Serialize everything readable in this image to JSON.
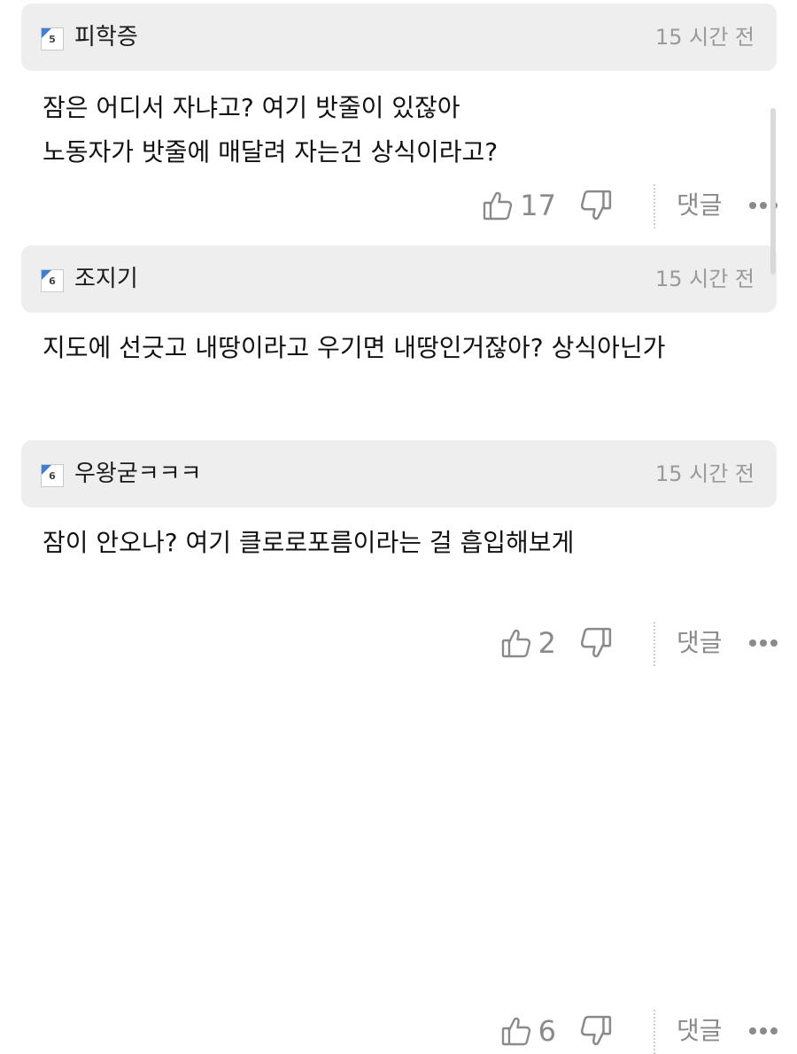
{
  "comments": [
    {
      "level": "5",
      "nickname": "피학증",
      "time": "15 시간 전",
      "lines": [
        "잠은 어디서 자냐고? 여기 밧줄이 있잖아",
        "노동자가 밧줄에 매달려 자는건 상식이라고?"
      ],
      "likes": "17",
      "reply_label": "댓글"
    },
    {
      "level": "6",
      "nickname": "조지기",
      "time": "15 시간 전",
      "lines": [
        "지도에 선긋고 내땅이라고 우기면 내땅인거잖아? 상식아닌가"
      ],
      "likes": "2",
      "reply_label": "댓글"
    },
    {
      "level": "6",
      "nickname": "우왕굳ㅋㅋㅋ",
      "time": "15 시간 전",
      "lines": [
        "잠이 안오나? 여기 클로로포름이라는 걸 흡입해보게"
      ],
      "likes": "6",
      "reply_label": "댓글"
    }
  ],
  "icons": {
    "level_badge": "level-badge-icon",
    "like": "thumbs-up-icon",
    "dislike": "thumbs-down-icon",
    "more": "more-dots-icon"
  },
  "colors": {
    "header_bg": "#eeeeee",
    "badge_flag": "#3f7fd8",
    "muted_text": "#8a8a8a",
    "time_text": "#9a9a9a"
  }
}
